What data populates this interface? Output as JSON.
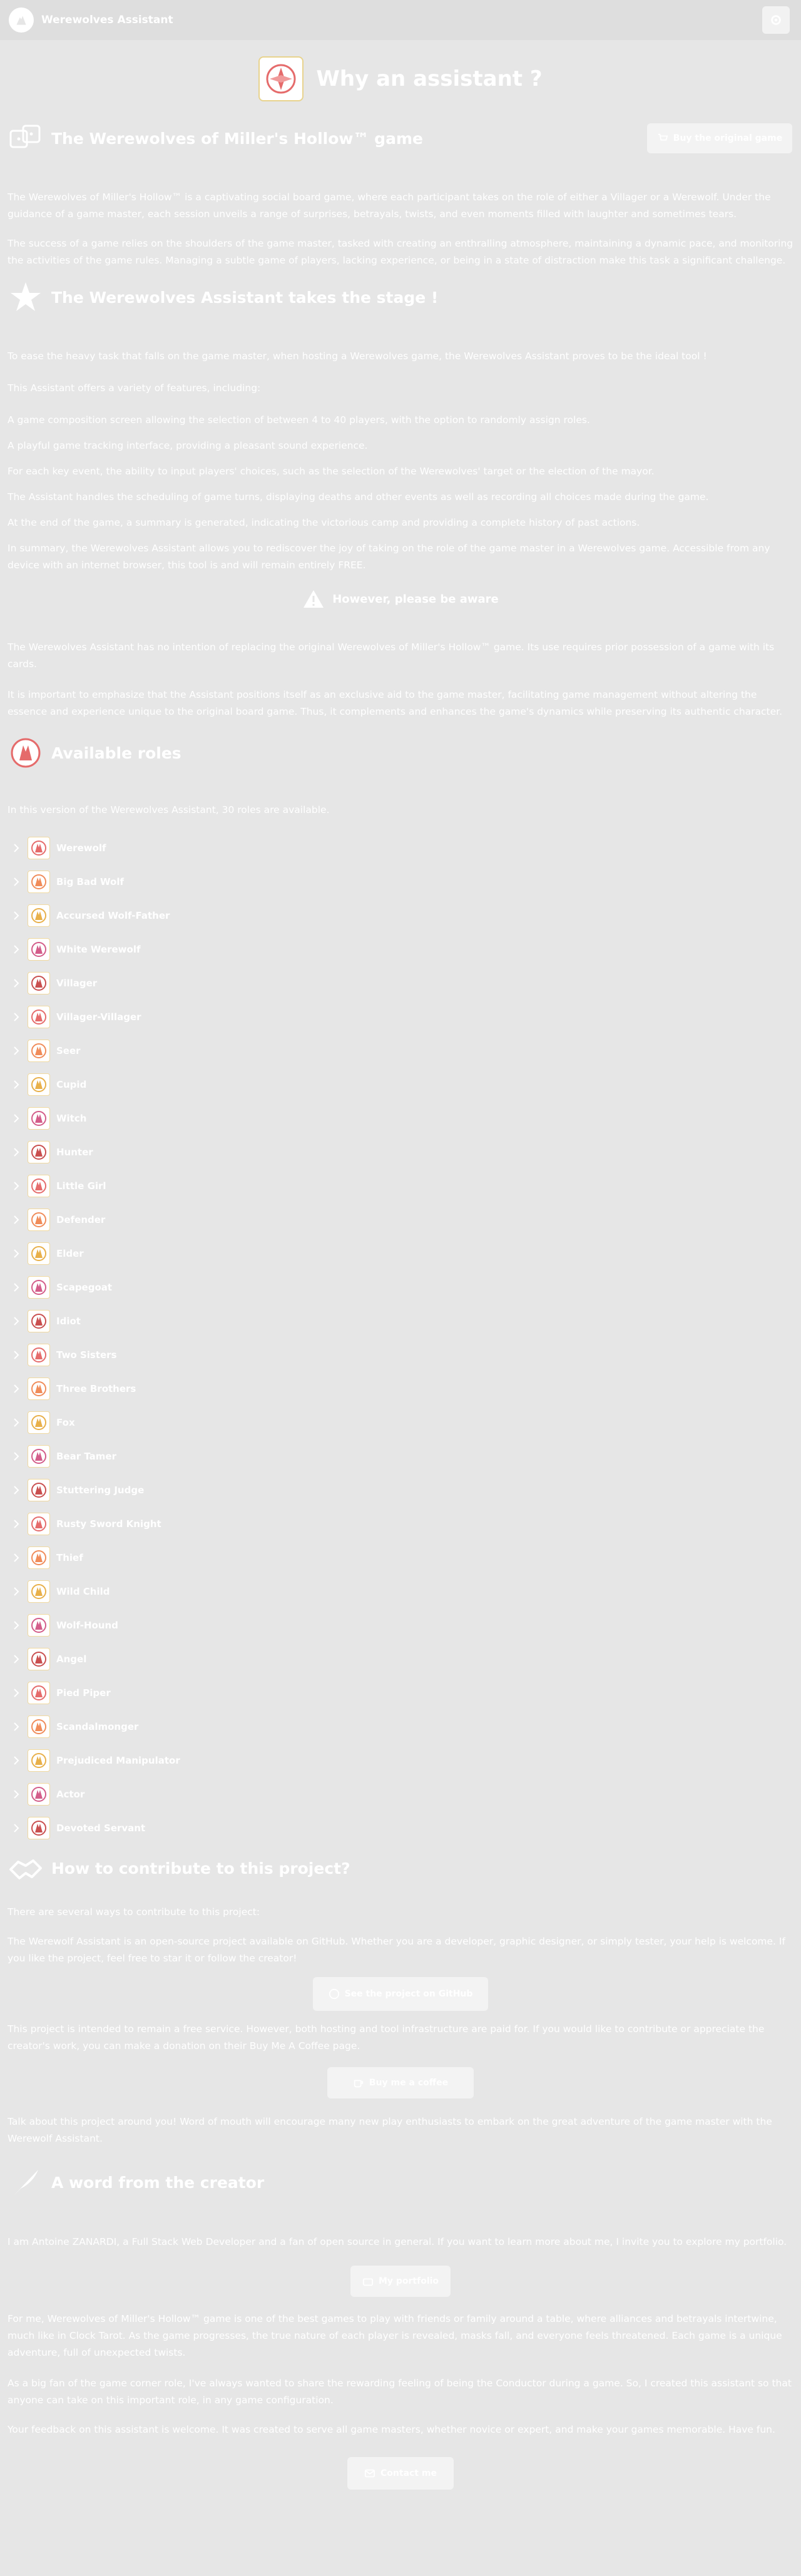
{
  "header": {
    "app_title": "Werewolves Assistant",
    "settings_icon": "gear-icon"
  },
  "page": {
    "title": "Why an assistant ?"
  },
  "game_section": {
    "title": "The Werewolves of Miller's Hollow™ game",
    "button_label": "Buy the original game",
    "p1": "The Werewolves of Miller's Hollow™ is a captivating social board game, where each participant takes on the role of either a Villager or a Werewolf. Under the guidance of a game master, each session unveils a range of surprises, betrayals, twists, and even moments filled with laughter and sometimes tears.",
    "p2": "The success of a game relies on the shoulders of the game master, tasked with creating an enthralling atmosphere, maintaining a dynamic pace, and monitoring the activities of the game rules. Managing a subtle game of players, lacking experience, or being in a state of distraction make this task a significant challenge."
  },
  "stage_section": {
    "title": "The Werewolves Assistant takes the stage !",
    "p1": "To ease the heavy task that falls on the game master, when hosting a Werewolves game, the Werewolves Assistant proves to be the ideal tool !",
    "p2": "This Assistant offers a variety of features, including:",
    "f1": "A game composition screen allowing the selection of between 4 to 40 players, with the option to randomly assign roles.",
    "f2": "A playful game tracking interface, providing a pleasant sound experience.",
    "f3": "For each key event, the ability to input players' choices, such as the selection of the Werewolves' target or the election of the mayor.",
    "f4": "The Assistant handles the scheduling of game turns, displaying deaths and other events as well as recording all choices made during the game.",
    "f5": "At the end of the game, a summary is generated, indicating the victorious camp and providing a complete history of past actions.",
    "p3": "In summary, the Werewolves Assistant allows you to rediscover the joy of taking on the role of the game master in a Werewolves game. Accessible from any device with an internet browser, this tool is and will remain entirely FREE.",
    "warning_title": "However, please be aware",
    "w1": "The Werewolves Assistant has no intention of replacing the original Werewolves of Miller's Hollow™ game. Its use requires prior possession of a game with its cards.",
    "w2": "It is important to emphasize that the Assistant positions itself as an exclusive aid to the game master, facilitating game management without altering the essence and experience unique to the original board game. Thus, it complements and enhances the game's dynamics while preserving its authentic character."
  },
  "roles_section": {
    "title": "Available roles",
    "intro": "In this version of the Werewolves Assistant, 30 roles are available.",
    "roles": [
      "Werewolf",
      "Big Bad Wolf",
      "Accursed Wolf-Father",
      "White Werewolf",
      "Villager",
      "Villager-Villager",
      "Seer",
      "Cupid",
      "Witch",
      "Hunter",
      "Little Girl",
      "Defender",
      "Elder",
      "Scapegoat",
      "Idiot",
      "Two Sisters",
      "Three Brothers",
      "Fox",
      "Bear Tamer",
      "Stuttering Judge",
      "Rusty Sword Knight",
      "Thief",
      "Wild Child",
      "Wolf-Hound",
      "Angel",
      "Pied Piper",
      "Scandalmonger",
      "Prejudiced Manipulator",
      "Actor",
      "Devoted Servant"
    ]
  },
  "contribute_section": {
    "title": "How to contribute to this project?",
    "p1": "There are several ways to contribute to this project:",
    "p2": "The Werewolf Assistant is an open-source project available on GitHub. Whether you are a developer, graphic designer, or simply tester, your help is welcome. If you like the project, feel free to star it or follow the creator!",
    "github_label": "See the project on GitHub",
    "p3": "This project is intended to remain a free service. However, both hosting and tool infrastructure are paid for. If you would like to contribute or appreciate the creator's work, you can make a donation on their Buy Me A Coffee page.",
    "coffee_label": "Buy me a coffee",
    "p4": "Talk about this project around you! Word of mouth will encourage many new play enthusiasts to embark on the great adventure of the game master with the Werewolf Assistant."
  },
  "creator_section": {
    "title": "A word from the creator",
    "p1": "I am Antoine ZANARDI, a Full Stack Web Developer and a fan of open source in general. If you want to learn more about me, I invite you to explore my portfolio.",
    "portfolio_label": "My portfolio",
    "p2": "For me, Werewolves of Miller's Hollow™ game is one of the best games to play with friends or family around a table, where alliances and betrayals intertwine, much like in Clock Tarot. As the game progresses, the true nature of each player is revealed, masks fall, and everyone feels threatened. Each game is a unique adventure, full of unexpected twists.",
    "p3": "As a big fan of the game corner role, I've always wanted to share the rewarding feeling of being the Conductor during a game. So, I created this assistant so that anyone can take on this important role, in any game configuration.",
    "p4": "Your feedback on this assistant is welcome. It was created to serve all game masters, whether novice or expert, and make your games memorable. Have fun.",
    "contact_label": "Contact me"
  }
}
